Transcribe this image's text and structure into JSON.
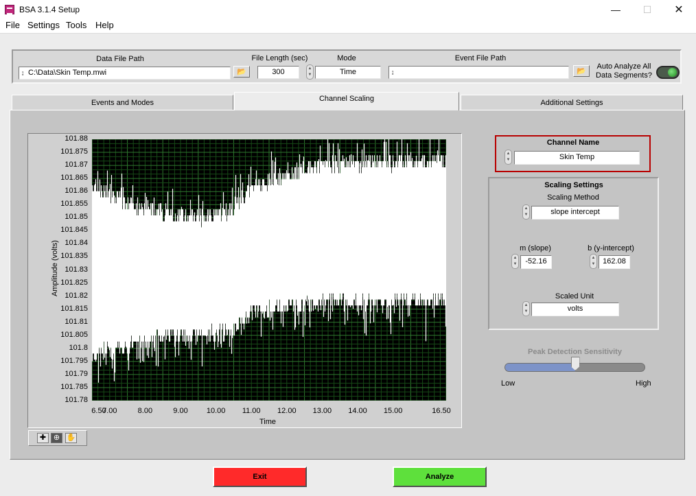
{
  "window": {
    "title": "BSA 3.1.4 Setup"
  },
  "menu": [
    "File",
    "Settings",
    "Tools",
    "Help"
  ],
  "top_panel": {
    "data_file_path_label": "Data File Path",
    "data_file_path_value": "C:\\Data\\Skin Temp.mwi",
    "file_length_label": "File Length (sec)",
    "file_length_value": "300",
    "mode_label": "Mode",
    "mode_value": "Time",
    "event_file_path_label": "Event File Path",
    "event_file_path_value": "",
    "auto_analyze_label_1": "Auto Analyze All",
    "auto_analyze_label_2": "Data Segments?"
  },
  "tabs": [
    {
      "label": "Events and Modes"
    },
    {
      "label": "Channel Scaling"
    },
    {
      "label": "Additional Settings"
    }
  ],
  "chart_data": {
    "type": "line",
    "xlabel": "Time",
    "ylabel": "Amplitude (volts)",
    "xlim": [
      6.5,
      16.5
    ],
    "ylim": [
      101.78,
      101.88
    ],
    "x_ticks": [
      "6.50",
      "7.00",
      "8.00",
      "9.00",
      "10.00",
      "11.00",
      "12.00",
      "13.00",
      "14.00",
      "15.00",
      "16.50"
    ],
    "y_ticks": [
      "101.88",
      "101.875",
      "101.87",
      "101.865",
      "101.86",
      "101.855",
      "101.85",
      "101.845",
      "101.84",
      "101.835",
      "101.83",
      "101.825",
      "101.82",
      "101.815",
      "101.81",
      "101.805",
      "101.8",
      "101.795",
      "101.79",
      "101.785",
      "101.78"
    ],
    "grid": true,
    "series": [
      {
        "color": "#ffffff",
        "band": [
          {
            "x": 6.5,
            "low": 101.798,
            "high": 101.862
          },
          {
            "x": 7.5,
            "low": 101.801,
            "high": 101.855
          },
          {
            "x": 8.5,
            "low": 101.805,
            "high": 101.852
          },
          {
            "x": 9.5,
            "low": 101.805,
            "high": 101.85
          },
          {
            "x": 10.5,
            "low": 101.807,
            "high": 101.853
          },
          {
            "x": 11.0,
            "low": 101.814,
            "high": 101.862
          },
          {
            "x": 12.0,
            "low": 101.816,
            "high": 101.866
          },
          {
            "x": 13.0,
            "low": 101.818,
            "high": 101.87
          },
          {
            "x": 14.0,
            "low": 101.818,
            "high": 101.871
          },
          {
            "x": 15.0,
            "low": 101.818,
            "high": 101.871
          },
          {
            "x": 16.5,
            "low": 101.818,
            "high": 101.872
          }
        ]
      }
    ]
  },
  "channel": {
    "name_label": "Channel Name",
    "name_value": "Skin Temp"
  },
  "scaling": {
    "title": "Scaling Settings",
    "method_label": "Scaling Method",
    "method_value": "slope intercept",
    "slope_label": "m (slope)",
    "slope_value": "-52.16",
    "intercept_label": "b (y-intercept)",
    "intercept_value": "162.08",
    "unit_label": "Scaled Unit",
    "unit_value": "volts"
  },
  "peak": {
    "label": "Peak Detection Sensitivity",
    "low": "Low",
    "high": "High",
    "value": 0.5
  },
  "buttons": {
    "exit": "Exit",
    "analyze": "Analyze",
    "exit_color": "#ff2a2a",
    "analyze_color": "#5ee03c"
  }
}
